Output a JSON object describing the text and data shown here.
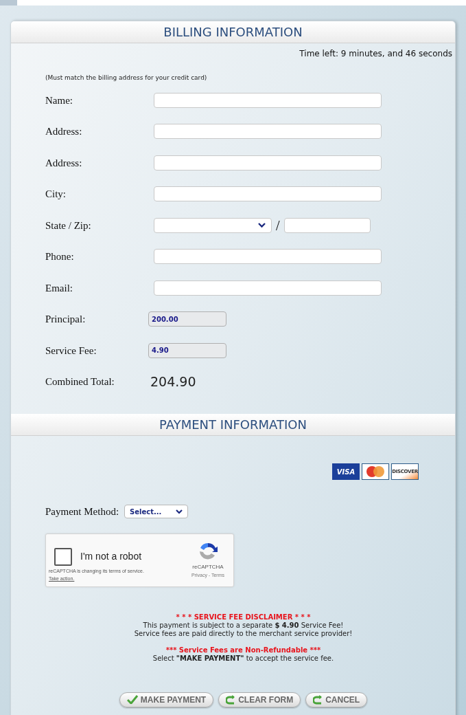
{
  "billing": {
    "title": "BILLING INFORMATION",
    "timer": "Time left: 9 minutes, and 46 seconds",
    "note": "(Must match the billing address for your credit card)",
    "fields": [
      {
        "label": "Name:",
        "kind": "text"
      },
      {
        "label": "Address:",
        "kind": "text"
      },
      {
        "label": "Address:",
        "kind": "text"
      },
      {
        "label": "City:",
        "kind": "text"
      },
      {
        "label": "State / Zip:",
        "kind": "statezip",
        "separator": "/"
      },
      {
        "label": "Phone:",
        "kind": "text"
      },
      {
        "label": "Email:",
        "kind": "text"
      },
      {
        "label": "Principal:",
        "kind": "readonly",
        "value": "200.00"
      },
      {
        "label": "Service Fee:",
        "kind": "readonly",
        "value": "4.90"
      },
      {
        "label": "Combined Total:",
        "kind": "total",
        "value": "204.90"
      }
    ]
  },
  "payment": {
    "title": "PAYMENT INFORMATION",
    "cards": [
      {
        "kind": "visa",
        "label": "VISA"
      },
      {
        "kind": "mastercard"
      },
      {
        "kind": "discover",
        "label": "DISCOVER"
      }
    ],
    "method": {
      "label": "Payment Method:",
      "value": "Select..."
    },
    "captcha": {
      "label": "I'm not a robot",
      "checked": false,
      "brand": "reCAPTCHA",
      "links": "Privacy - Terms",
      "notice": "reCAPTCHA is changing its terms of service.",
      "action": "Take action."
    },
    "disclaimer": [
      {
        "kind": "warning",
        "text": "* * * SERVICE FEE DISCLAIMER * * *"
      },
      {
        "kind": "body",
        "text": "This payment is subject to a separate **$ 4.90** Service Fee!"
      },
      {
        "kind": "body",
        "text": "Service fees are paid directly to the merchant service provider!"
      },
      {
        "kind": "gap"
      },
      {
        "kind": "warning",
        "text": "*** Service Fees are Non-Refundable ***"
      },
      {
        "kind": "body",
        "text": "Select **\"MAKE PAYMENT\"** to accept the service fee."
      }
    ],
    "buttons": [
      {
        "kind": "check",
        "label": "MAKE PAYMENT"
      },
      {
        "kind": "reset",
        "label": "CLEAR FORM"
      },
      {
        "kind": "reset",
        "label": "CANCEL"
      }
    ]
  }
}
